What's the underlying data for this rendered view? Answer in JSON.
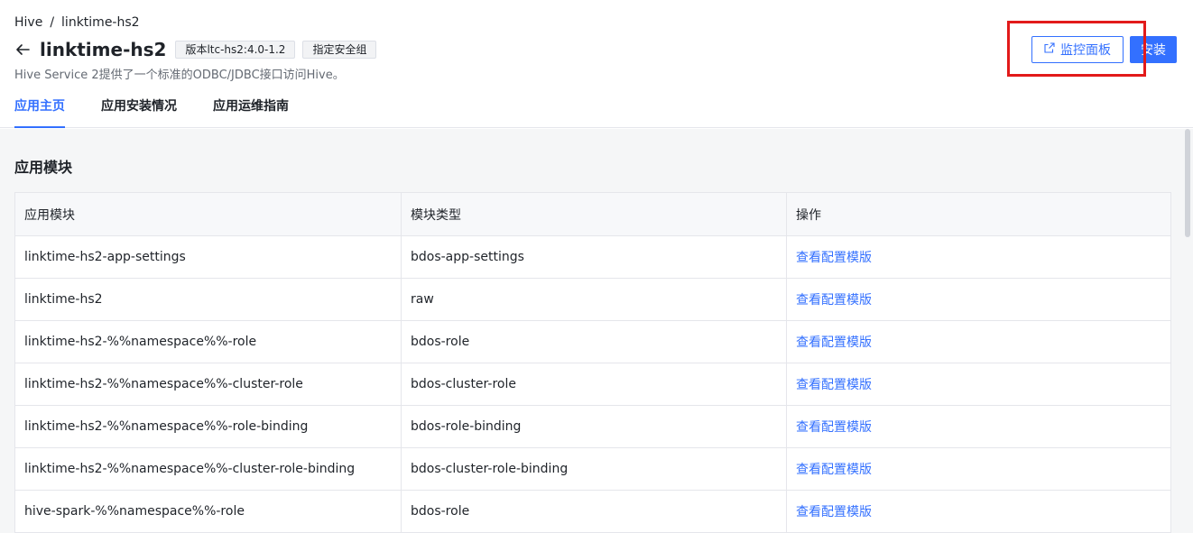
{
  "breadcrumb": {
    "root": "Hive",
    "separator": "/",
    "current": "linktime-hs2"
  },
  "header": {
    "title": "linktime-hs2",
    "tags": [
      "版本ltc-hs2:4.0-1.2",
      "指定安全组"
    ],
    "description": "Hive Service 2提供了一个标准的ODBC/JDBC接口访问Hive。",
    "monitor_label": "监控面板",
    "install_label": "安装"
  },
  "tabs": [
    {
      "label": "应用主页",
      "active": true
    },
    {
      "label": "应用安装情况",
      "active": false
    },
    {
      "label": "应用运维指南",
      "active": false
    }
  ],
  "section": {
    "title": "应用模块"
  },
  "table": {
    "headers": [
      "应用模块",
      "模块类型",
      "操作"
    ],
    "rows": [
      {
        "module": "linktime-hs2-app-settings",
        "type": "bdos-app-settings",
        "action": "查看配置模版"
      },
      {
        "module": "linktime-hs2",
        "type": "raw",
        "action": "查看配置模版"
      },
      {
        "module": "linktime-hs2-%%namespace%%-role",
        "type": "bdos-role",
        "action": "查看配置模版"
      },
      {
        "module": "linktime-hs2-%%namespace%%-cluster-role",
        "type": "bdos-cluster-role",
        "action": "查看配置模版"
      },
      {
        "module": "linktime-hs2-%%namespace%%-role-binding",
        "type": "bdos-role-binding",
        "action": "查看配置模版"
      },
      {
        "module": "linktime-hs2-%%namespace%%-cluster-role-binding",
        "type": "bdos-cluster-role-binding",
        "action": "查看配置模版"
      },
      {
        "module": "hive-spark-%%namespace%%-role",
        "type": "bdos-role",
        "action": "查看配置模版"
      }
    ]
  },
  "colors": {
    "accent": "#3370ff",
    "highlight": "#e21a1a"
  }
}
